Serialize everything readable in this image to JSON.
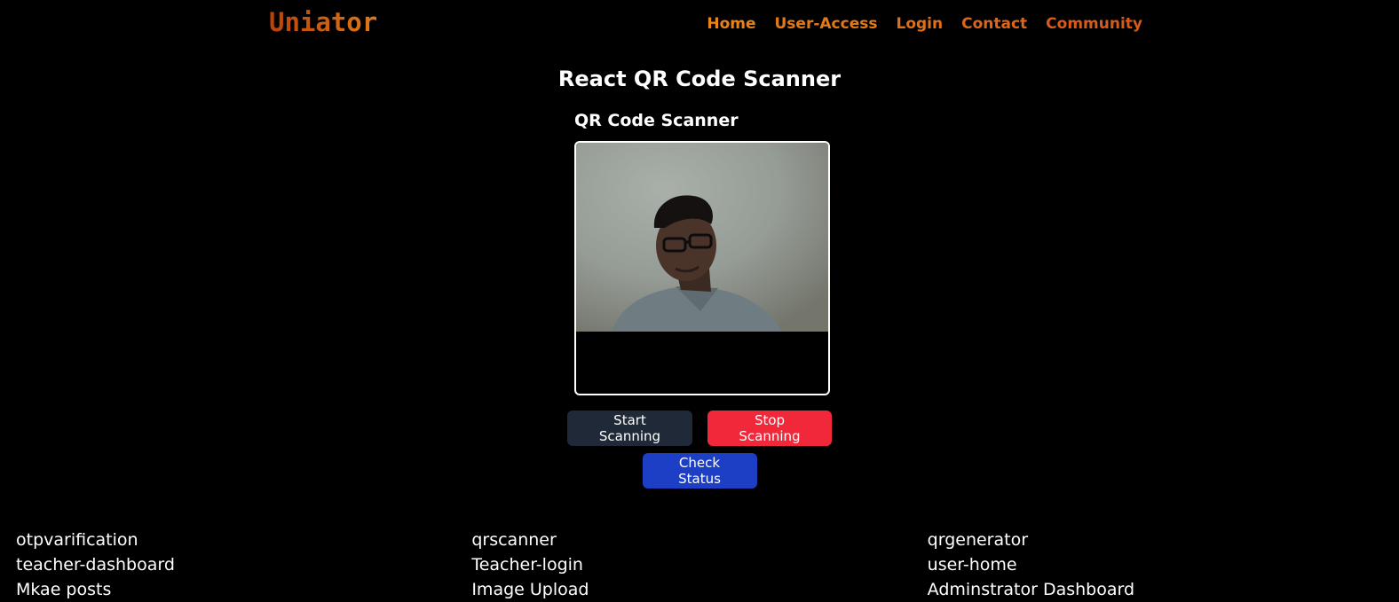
{
  "header": {
    "brand": "Uniator",
    "nav": [
      "Home",
      "User-Access",
      "Login",
      "Contact",
      "Community"
    ]
  },
  "main": {
    "title": "React QR Code Scanner",
    "scanner_title": "QR Code Scanner",
    "start_label": "Start Scanning",
    "stop_label": "Stop Scanning",
    "check_label": "Check Status"
  },
  "footer": {
    "col1": [
      "otpvarification",
      "teacher-dashboard",
      "Mkae posts"
    ],
    "col2": [
      "qrscanner",
      "Teacher-login",
      "Image Upload"
    ],
    "col3": [
      "qrgenerator",
      "user-home",
      "Adminstrator Dashboard"
    ]
  },
  "colors": {
    "background": "#000000",
    "nav": "#e07519",
    "start_button": "#1f2937",
    "stop_button": "#f0283a",
    "check_button": "#1d3fc6"
  }
}
